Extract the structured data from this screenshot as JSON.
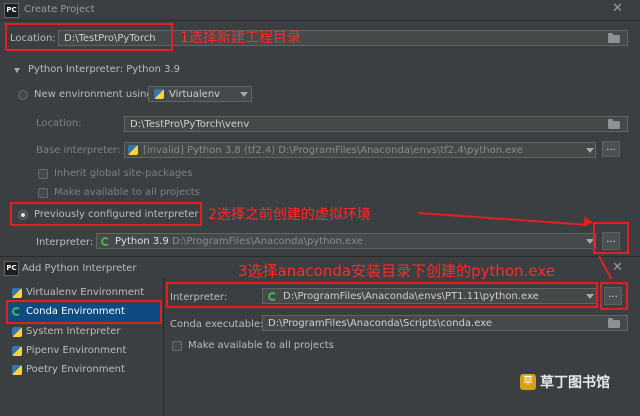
{
  "create_project": {
    "window_title": "Create Project",
    "app_badge": "PC",
    "location_label": "Location:",
    "location_value": "D:\\TestPro\\PyTorch",
    "interpreter_section": "Python Interpreter: Python 3.9",
    "new_env_label": "New environment using",
    "new_env_tool": "Virtualenv",
    "env_location_label": "Location:",
    "env_location_value": "D:\\TestPro\\PyTorch\\venv",
    "base_interpreter_label": "Base interpreter:",
    "base_interpreter_value": "[invalid] Python 3.8 (tf2.4) D:\\ProgramFiles\\Anaconda\\envs\\tf2.4\\python.exe",
    "inherit_label": "Inherit global site-packages",
    "make_available_label": "Make available to all projects",
    "previously_configured_label": "Previously configured interpreter",
    "interpreter_label": "Interpreter:",
    "interpreter_name": "Python 3.9",
    "interpreter_path": "D:\\ProgramFiles\\Anaconda\\python.exe",
    "browse_label": "..."
  },
  "add_interpreter": {
    "window_title": "Add Python Interpreter",
    "app_badge": "PC",
    "sidebar_items": [
      {
        "label": "Virtualenv Environment"
      },
      {
        "label": "Conda Environment"
      },
      {
        "label": "System Interpreter"
      },
      {
        "label": "Pipenv Environment"
      },
      {
        "label": "Poetry Environment"
      }
    ],
    "selected_item": "Conda Environment",
    "interpreter_label": "Interpreter:",
    "interpreter_value": "D:\\ProgramFiles\\Anaconda\\envs\\PT1.11\\python.exe",
    "conda_exec_label": "Conda executable:",
    "conda_exec_value": "D:\\ProgramFiles\\Anaconda\\Scripts\\conda.exe",
    "make_available_label": "Make available to all projects",
    "browse_label": "..."
  },
  "annotations": {
    "step1": "1选择新建工程目录",
    "step2": "2选择之前创建的虚拟环境",
    "step3": "3选择anaconda安装目录下创建的python.exe"
  },
  "watermark": {
    "text": "草丁图书馆"
  },
  "colors": {
    "background": "#3c3f41",
    "field": "#45494a",
    "selection": "#0d4b82",
    "annotation": "#e32020"
  }
}
